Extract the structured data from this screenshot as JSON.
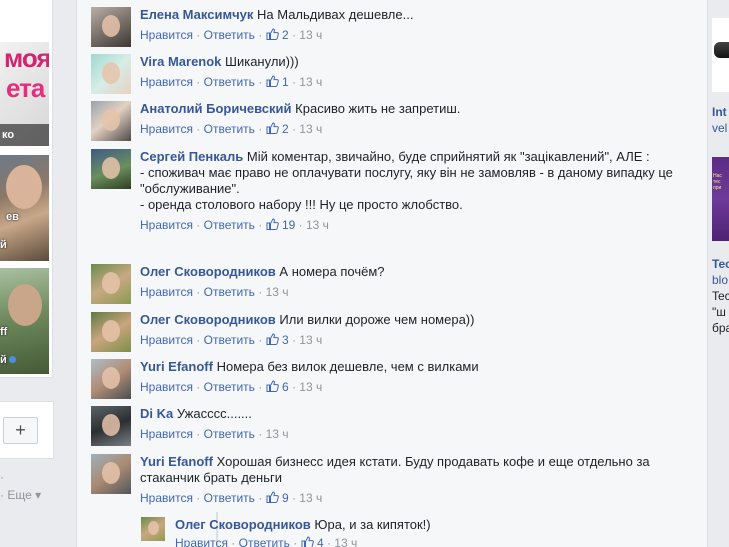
{
  "left": {
    "thumb1": {
      "brand_line1": "моя",
      "brand_line2": "ета",
      "caption": "ко"
    },
    "thumb2": {
      "caption": "ев",
      "caption2": "й"
    },
    "thumb3": {
      "caption": "ff",
      "caption2": "й"
    },
    "add_label": "+",
    "footer_dot": "·",
    "footer_more": "· Еще ▾"
  },
  "comments": [
    {
      "author": "Елена Максимчук",
      "text": "На Мальдивах дешевле...",
      "like": "Нравится",
      "reply": "Ответить",
      "count": "2",
      "time": "13 ч"
    },
    {
      "author": "Vira Marenok",
      "text": "Шиканули)))",
      "like": "Нравится",
      "reply": "Ответить",
      "count": "1",
      "time": "13 ч"
    },
    {
      "author": "Анатолий Боричевский",
      "text": "Красиво жить не запретиш.",
      "like": "Нравится",
      "reply": "Ответить",
      "count": "2",
      "time": "13 ч"
    },
    {
      "author": "Сергей Пенкаль",
      "text": "Мій коментар, звичайно, буде сприйнятий як \"зацікавлений\", АЛЕ :\n- споживач має право не оплачувати послугу, яку він не замовляв - в даному випадку це \"обслуживание\".\n- оренда столового набору !!! Ну це просто жлобство.",
      "like": "Нравится",
      "reply": "Ответить",
      "count": "19",
      "time": "13 ч"
    },
    {
      "author": "Олег Сковородников",
      "text": "А номера почём?",
      "like": "Нравится",
      "reply": "Ответить",
      "count": "",
      "time": "13 ч"
    },
    {
      "author": "Олег Сковородников",
      "text": "Или вилки дороже чем номера))",
      "like": "Нравится",
      "reply": "Ответить",
      "count": "3",
      "time": "13 ч"
    },
    {
      "author": "Yuri Efanoff",
      "text": "Номера без вилок дешевле, чем с вилками",
      "like": "Нравится",
      "reply": "Ответить",
      "count": "6",
      "time": "13 ч"
    },
    {
      "author": "Di Ka",
      "text": "Ужасссс.......",
      "like": "Нравится",
      "reply": "Ответить",
      "count": "",
      "time": "13 ч"
    },
    {
      "author": "Yuri Efanoff",
      "text": "Хорошая бизнесс идея кстати. Буду продавать кофе и еще отдельно за стаканчик брать деньги",
      "like": "Нравится",
      "reply": "Ответить",
      "count": "9",
      "time": "13 ч"
    },
    {
      "author": "Олег Сковородников",
      "text": "Юра, и за кипяток!)",
      "like": "Нравится",
      "reply": "Ответить",
      "count": "4",
      "time": "13 ч"
    }
  ],
  "right": {
    "title1": "Int",
    "sub1": "vel",
    "img2_text": "Нас тес при",
    "title2": "Tec",
    "sub2": "blo",
    "line1": "Tec",
    "line2": "\"ш",
    "line3": "бра"
  },
  "colors": {
    "link": "#365899",
    "action": "#4267b2",
    "meta": "#90949c",
    "panel": "#f6f7f9",
    "page": "#e9ebee"
  }
}
